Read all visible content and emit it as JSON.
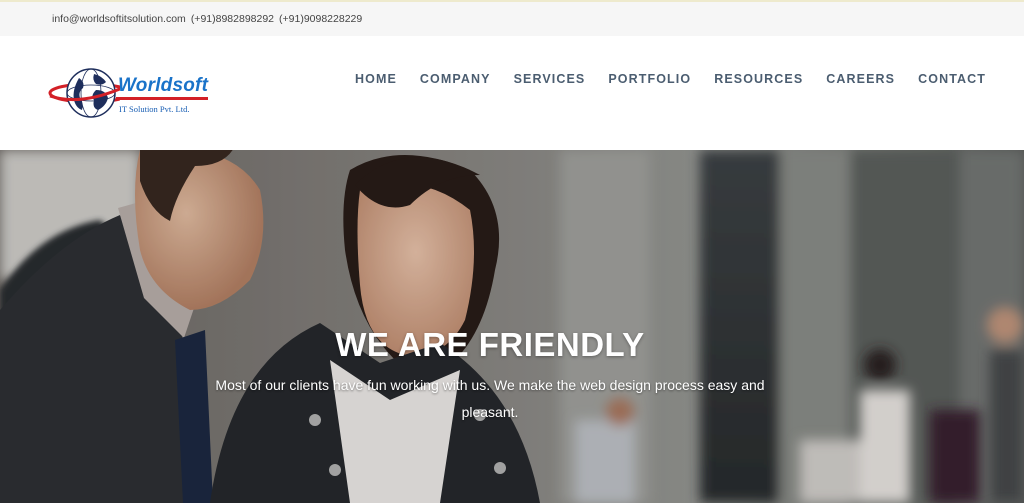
{
  "topbar": {
    "email": "info@worldsoftitsolution.com",
    "phone1": "(+91)8982898292",
    "phone2": "(+91)9098228229"
  },
  "logo": {
    "brand": "Worldsoft",
    "tagline": "IT Solution Pvt. Ltd.",
    "icon": "globe-icon"
  },
  "nav": {
    "items": [
      "HOME",
      "COMPANY",
      "SERVICES",
      "PORTFOLIO",
      "RESOURCES",
      "CAREERS",
      "CONTACT"
    ]
  },
  "hero": {
    "title": "WE ARE FRIENDLY",
    "text": "Most of our clients have fun working with us. We make the web design process easy and pleasant."
  },
  "colors": {
    "nav_text": "#4b5d70",
    "brand_blue": "#1a73c9",
    "brand_red": "#d32027",
    "topbar_bg": "#f6f6f6"
  }
}
